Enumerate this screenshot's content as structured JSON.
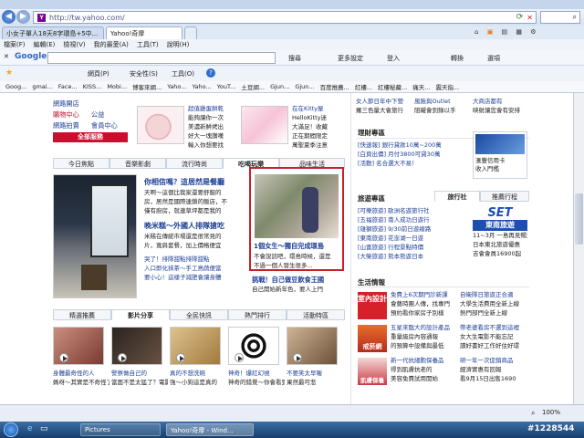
{
  "browser": {
    "url": "http://tw.yahoo.com/",
    "tabs": [
      "小女子單人18天8字環島+5中...",
      "Yahoo!奇摩"
    ],
    "menu": [
      "檔案(F)",
      "編輯(E)",
      "檢視(V)",
      "我的最愛(A)",
      "工具(T)",
      "說明(H)"
    ],
    "google_label": "Google",
    "google_items": [
      "搜尋",
      "更多設定",
      "登入",
      "轉換",
      "選項"
    ],
    "cmd_items": [
      "網頁(P)",
      "安全性(S)",
      "工具(O)"
    ],
    "favorites": [
      "Goog...",
      "gmai...",
      "Face...",
      "KISS...",
      "Mobi...",
      "博客來網...",
      "Yaho...",
      "Yaho...",
      "YouT...",
      "土豆網...",
      "Gjun...",
      "Gjun...",
      "百度推薦...",
      "紅樓...",
      "紅樓秘藏...",
      "痛天...",
      "震天指..."
    ],
    "status_zoom": "100%",
    "taskbar": [
      "Pictures",
      "Yahoo!奇摩 - Wind..."
    ],
    "clock_tag": "#1228544"
  },
  "page": {
    "left_links": [
      "網路開店",
      "購物中心",
      "網路拍賣",
      "全部服務"
    ],
    "left_links2": [
      "公益",
      "會員中心"
    ],
    "promo1": [
      "超值雞蛋餅乾",
      "能夠讓你一次",
      "美濃新鮮烤出",
      "好大一塊讚嘆",
      "輸入你想要找"
    ],
    "promo2": [
      "在在Kitty屋",
      "HelloKitty迷",
      "大滿足！收藏",
      "正在期間限定",
      "萬聖夏季注意"
    ],
    "tabs": [
      "今日焦點",
      "音樂影劇",
      "流行時尚",
      "吃喝玩樂",
      "品味生活"
    ],
    "feature_title": "你相信嗎？這居然是餐廳",
    "feature_lines": [
      "天啊～這個比我家還要舒服的",
      "房，居然是國際連鎖的飯店，不",
      "僅有廚房，就連草坪都是我的"
    ],
    "sub_title": "晚米糕～外國人排隊搶吃",
    "sub_lines": [
      "米糕在傳統市場還是很常見的",
      "片，寬肩套餐，加上價格便宜"
    ],
    "bullets": [
      "哭了！排隊甜點排隊甜點",
      "入口即化抹茶～手工鳥蔬便當",
      "要小心！這樣子減肥會讓身體"
    ],
    "highlight_title": "1個女生～獨自完成環島",
    "highlight_lines": [
      "不會說話吧，環島時候，還是",
      "不過一個人發生很多..."
    ],
    "red_title": "挑戰！自己做豆飲食王國",
    "red_lines": [
      "自己開始新年色，要人上門"
    ],
    "video_tabs": [
      "精選推薦",
      "影片分享",
      "全民快訊",
      "熱門排行",
      "活動特區"
    ],
    "video_captions": [
      "身體最奇怪的人",
      "警察做自己的",
      "真的不想洗碗",
      "神奇！爆紅幻視",
      "不要笑太早喔"
    ],
    "video_subs": [
      "媽呀～其實是不奇怪了～都可以",
      "當面不是太猛了？電影看起來",
      "強～小狗這是真的",
      "神奇的錯覺～你會看到",
      "果然最可悲"
    ],
    "right_top_lines": [
      "女人節日年中下營",
      "羅三色量大會旅行",
      "風險與Outlet",
      "阻礙會到錄以手",
      "大商店都有",
      "映射讓您會有安排"
    ],
    "right_section1": "理財專區",
    "finance_items": [
      "[快速報] 銀行貸款10萬~200萬",
      "[白頁出價] 月付3800可貸30萬",
      "[活動] 名合選大不易！"
    ],
    "right_box1": [
      "滙豐信用卡",
      "信用卡...",
      "收入門檻",
      "辦卡送禮"
    ],
    "right_section2": "旅遊專區",
    "travel_tabs": [
      "旅行社",
      "推薦行程"
    ],
    "travel_items": [
      "[可樂旅遊] 歐洲名遊旅行社",
      "[五福旅遊] 南人成功日遊行",
      "[雄獅旅遊] 9/30前日遊線路",
      "[東南旅遊] 花澎湖一日遊",
      "[山富旅遊] 行程景點特價",
      "[大榮旅遊] 熊本熊遊日本"
    ],
    "set_logo": "SET",
    "set_name": "東南旅遊",
    "set_lines": [
      "11~3月 一島再見暢遊",
      "日本東北旅遊優惠",
      "吉會會員16900起"
    ],
    "life_section": "生活情報",
    "life1_box": "室內設計",
    "life1_lines": [
      "免費上6次期門診新課",
      "會藝時團人傳，找專門",
      "預約看你家房子別樣"
    ],
    "life2_box": "戒菸網",
    "life2_lines": [
      "五星來臨大的設計產品",
      "重量級房內容通報",
      "的預算中設備與最低"
    ],
    "life3_box": "肌膚保養",
    "life3_lines": [
      "新一代抗細胞保養品",
      "得到肌膚抗老的",
      "美容免費試用開始"
    ],
    "life_right": [
      "自衛隊日旅遊正合適",
      "大學生活費用全新上線",
      "熱門部門全新上線",
      "帶老婆看房不選到這裡",
      "女大生電影不能忘記",
      "讀好書好工作好住好環",
      "研一年一次促銷商品",
      "經濟實惠有回報",
      "看9月15日出售1690"
    ]
  }
}
